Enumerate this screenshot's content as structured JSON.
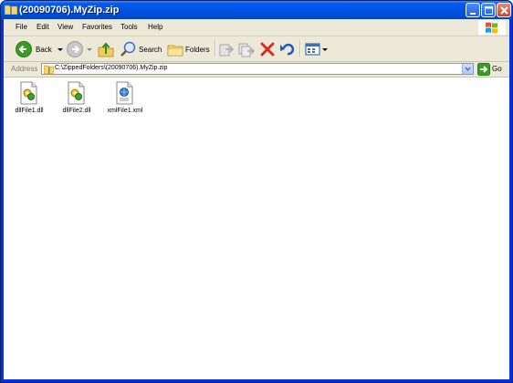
{
  "window": {
    "title": "(20090706).MyZip.zip"
  },
  "menu": {
    "items": [
      "File",
      "Edit",
      "View",
      "Favorites",
      "Tools",
      "Help"
    ]
  },
  "toolbar": {
    "back_label": "Back",
    "search_label": "Search",
    "folders_label": "Folders"
  },
  "address": {
    "label": "Address",
    "value": "C:\\ZippedFolders\\(20090706).MyZip.zip",
    "go_label": "Go"
  },
  "files": [
    {
      "name": "dllFile1.dll",
      "icon": "dll-file-icon"
    },
    {
      "name": "dllFile2.dll",
      "icon": "dll-file-icon"
    },
    {
      "name": "xmlFile1.xml",
      "icon": "xml-file-icon"
    }
  ],
  "colors": {
    "titlebar": "#0054e3",
    "close_button": "#cc4422",
    "chrome": "#ece9d8"
  }
}
